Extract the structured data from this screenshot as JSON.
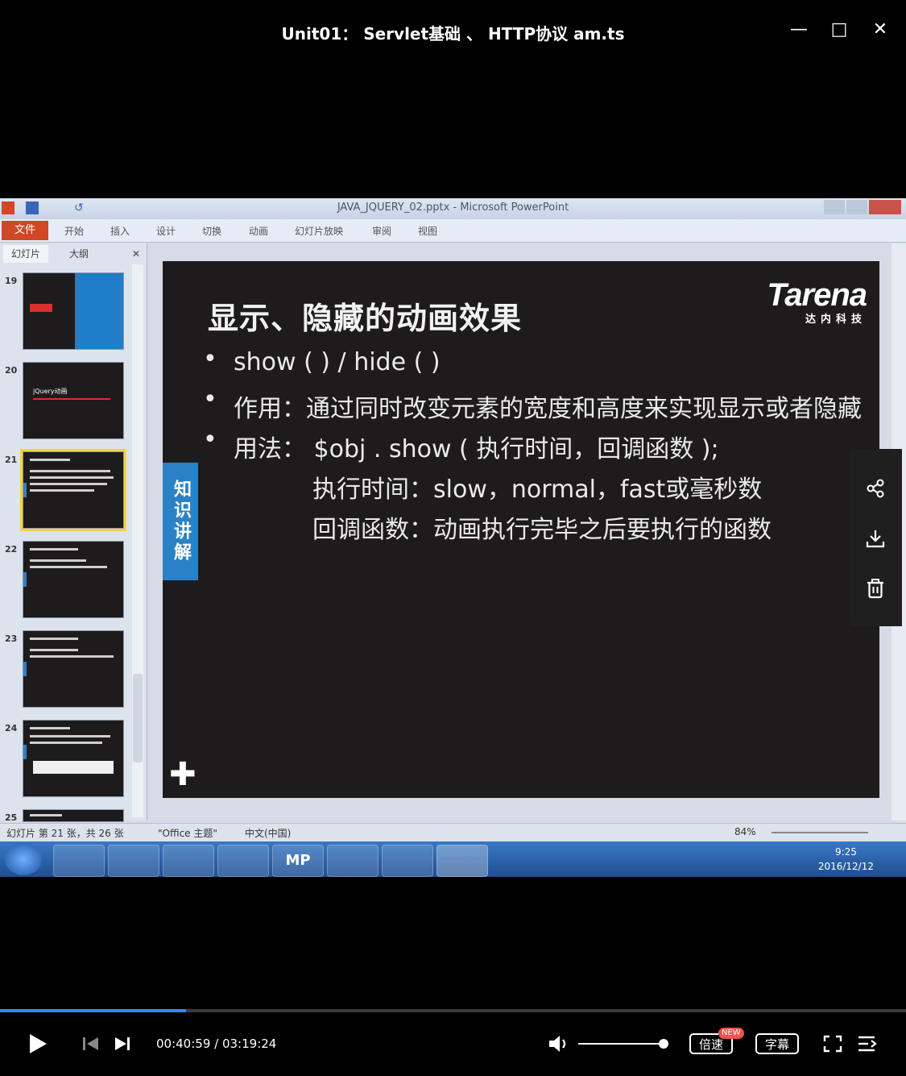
{
  "player": {
    "title": "Unit01： Servlet基础 、 HTTP协议 am.ts",
    "minimize": "—",
    "maximize": "□",
    "close": "✕"
  },
  "powerpoint": {
    "title": "JAVA_JQUERY_02.pptx - Microsoft PowerPoint",
    "file_tab": "文件",
    "ribbon_tabs": [
      "开始",
      "插入",
      "设计",
      "切换",
      "动画",
      "幻灯片放映",
      "审阅",
      "视图"
    ],
    "panel_tabs": [
      "幻灯片",
      "大纲"
    ],
    "thumbnails": [
      {
        "num": "19"
      },
      {
        "num": "20",
        "label": "jQuery动画"
      },
      {
        "num": "21"
      },
      {
        "num": "22"
      },
      {
        "num": "23"
      },
      {
        "num": "24"
      },
      {
        "num": "25"
      }
    ],
    "status": {
      "slide_info": "幻灯片 第 21 张，共 26 张",
      "theme": "\"Office 主题\"",
      "language": "中文(中国)",
      "zoom": "84%"
    }
  },
  "slide": {
    "title": "显示、隐藏的动画效果",
    "logo": "Tarena",
    "logo_sub": "达内科技",
    "side_tag": "知识讲解",
    "bullets": [
      "show ( ) / hide ( )",
      "作用：通过同时改变元素的宽度和高度来实现显示或者隐藏",
      "用法： $obj . show ( 执行时间，回调函数 );"
    ],
    "sub_lines": [
      "执行时间：slow，normal，fast或毫秒数",
      "回调函数：动画执行完毕之后要执行的函数"
    ]
  },
  "taskbar": {
    "items": [
      "MP"
    ],
    "time": "9:25",
    "date": "2016/12/12"
  },
  "controls": {
    "time_current": "00:40:59",
    "time_sep": " / ",
    "time_total": "03:19:24",
    "progress": 0.205,
    "volume": 1.0,
    "speed_label": "倍速",
    "new_badge": "NEW",
    "subtitle_label": "字幕"
  }
}
